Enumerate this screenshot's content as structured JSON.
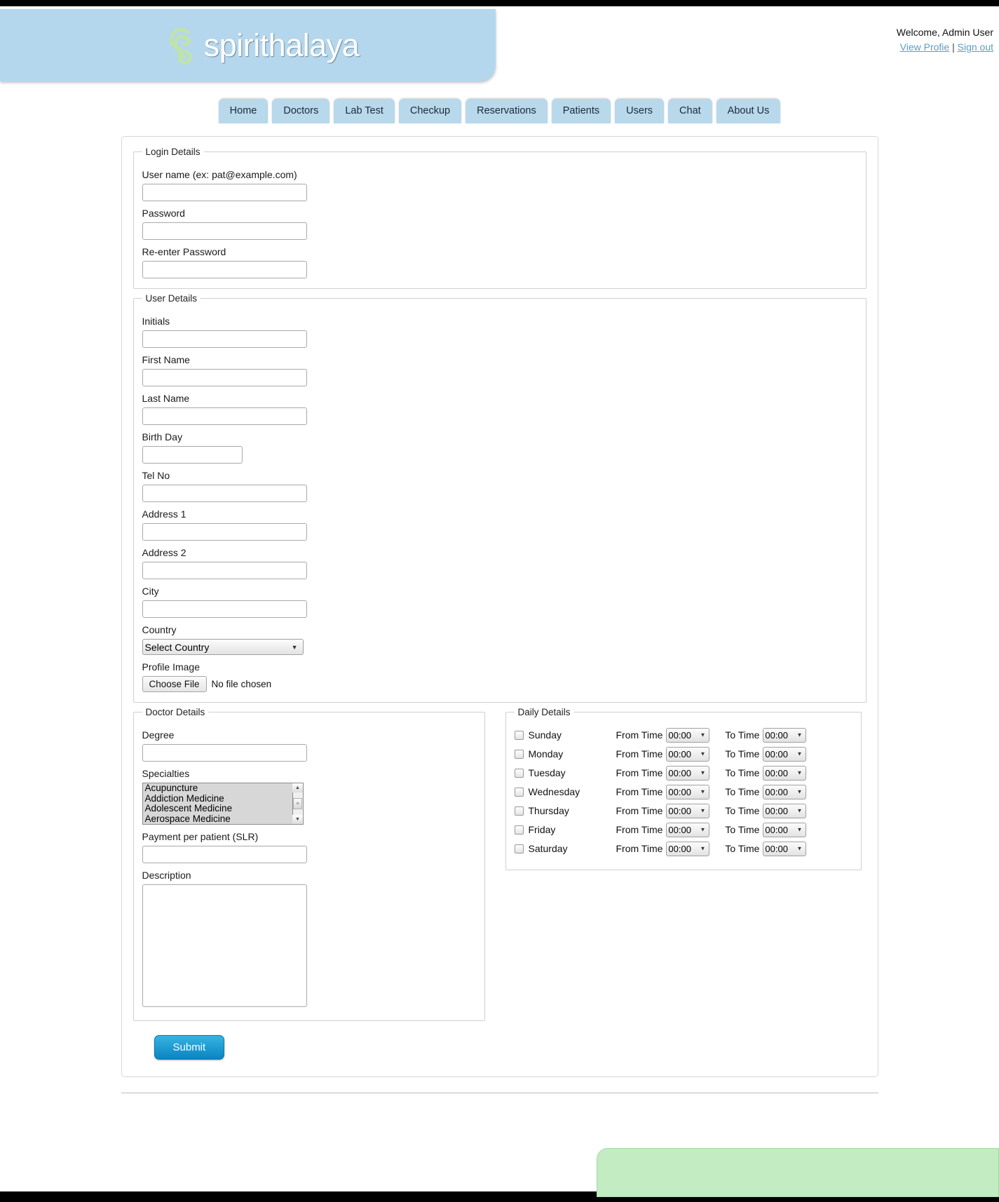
{
  "brand": {
    "name": "spirithalaya",
    "logo_icon": "spiral-ear-logo-icon",
    "band_color": "#b4d7ed",
    "logo_color": "#c3e8ab"
  },
  "header": {
    "welcome_text": "Welcome, Admin User",
    "view_profile_label": "View Profie",
    "separator": "|",
    "sign_out_label": "Sign out"
  },
  "nav": {
    "items": [
      {
        "label": "Home"
      },
      {
        "label": "Doctors"
      },
      {
        "label": "Lab Test"
      },
      {
        "label": "Checkup"
      },
      {
        "label": "Reservations"
      },
      {
        "label": "Patients"
      },
      {
        "label": "Users"
      },
      {
        "label": "Chat"
      },
      {
        "label": "About Us"
      }
    ]
  },
  "login_details": {
    "legend": "Login Details",
    "fields": [
      {
        "label": "User name (ex: pat@example.com)",
        "value": "",
        "placeholder": ""
      },
      {
        "label": "Password",
        "value": "",
        "placeholder": ""
      },
      {
        "label": "Re-enter Password",
        "value": "",
        "placeholder": ""
      }
    ]
  },
  "user_details": {
    "legend": "User Details",
    "fields": [
      {
        "label": "Initials",
        "value": ""
      },
      {
        "label": "First Name",
        "value": ""
      },
      {
        "label": "Last Name",
        "value": ""
      },
      {
        "label": "Birth Day",
        "value": ""
      },
      {
        "label": "Tel No",
        "value": ""
      },
      {
        "label": "Address 1",
        "value": ""
      },
      {
        "label": "Address 2",
        "value": ""
      },
      {
        "label": "City",
        "value": ""
      }
    ],
    "country": {
      "label": "Country",
      "selected": "Select Country",
      "options": [
        "Select Country"
      ]
    },
    "profile_image": {
      "label": "Profile Image",
      "button_label": "Choose File",
      "status": "No file chosen"
    }
  },
  "doctor_details": {
    "legend": "Doctor Details",
    "degree": {
      "label": "Degree",
      "value": ""
    },
    "specialties": {
      "label": "Specialties",
      "options": [
        "Acupuncture",
        "Addiction Medicine",
        "Adolescent Medicine",
        "Aerospace Medicine"
      ]
    },
    "payment": {
      "label": "Payment per patient (SLR)",
      "value": ""
    },
    "description": {
      "label": "Description",
      "value": ""
    }
  },
  "daily_details": {
    "legend": "Daily Details",
    "from_label": "From Time",
    "to_label": "To Time",
    "default_time": "00:00",
    "days": [
      {
        "name": "Sunday",
        "checked": false,
        "from": "00:00",
        "to": "00:00"
      },
      {
        "name": "Monday",
        "checked": false,
        "from": "00:00",
        "to": "00:00"
      },
      {
        "name": "Tuesday",
        "checked": false,
        "from": "00:00",
        "to": "00:00"
      },
      {
        "name": "Wednesday",
        "checked": false,
        "from": "00:00",
        "to": "00:00"
      },
      {
        "name": "Thursday",
        "checked": false,
        "from": "00:00",
        "to": "00:00"
      },
      {
        "name": "Friday",
        "checked": false,
        "from": "00:00",
        "to": "00:00"
      },
      {
        "name": "Saturday",
        "checked": false,
        "from": "00:00",
        "to": "00:00"
      }
    ]
  },
  "actions": {
    "submit_label": "Submit"
  },
  "footer": {
    "band_color": "#c3ecc2",
    "text": ""
  }
}
